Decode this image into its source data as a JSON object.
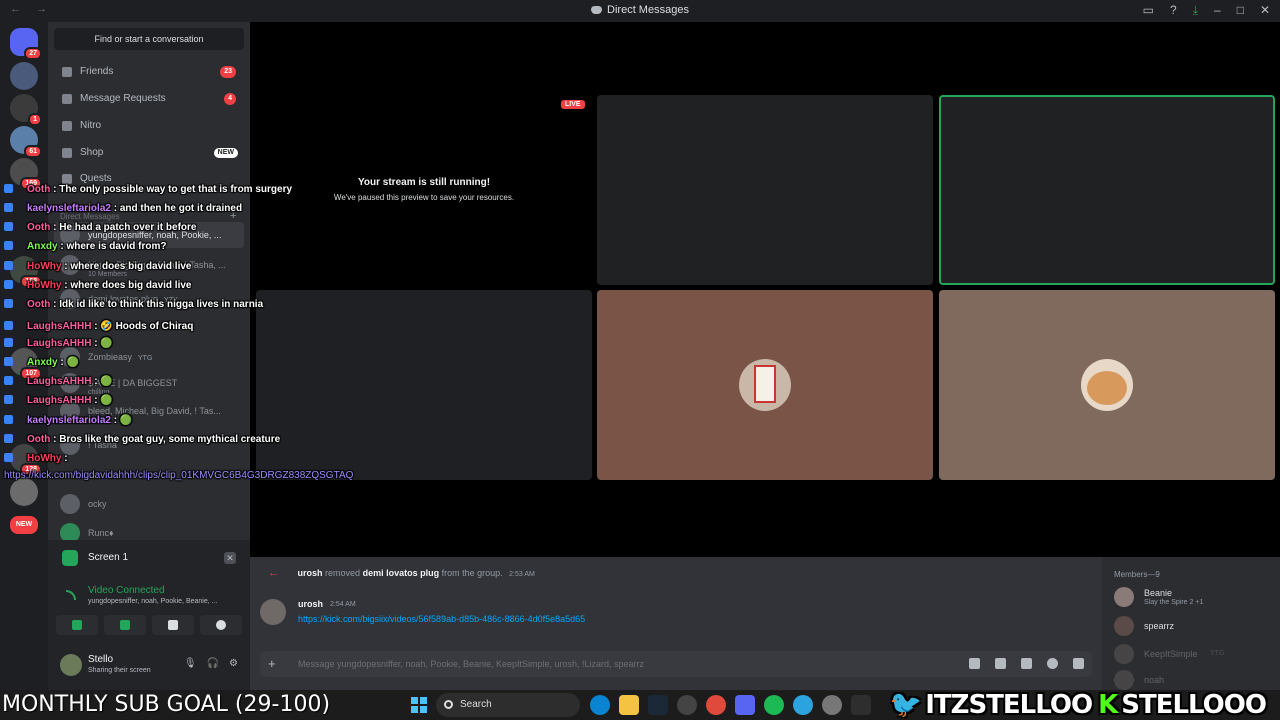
{
  "window": {
    "title": "Direct Messages",
    "nav": "←  →"
  },
  "search": {
    "label": "Find or start a conversation"
  },
  "nav": [
    {
      "label": "Friends",
      "count": "23"
    },
    {
      "label": "Message Requests",
      "count": "4"
    },
    {
      "label": "Nitro"
    },
    {
      "label": "Shop",
      "badge": "NEW"
    },
    {
      "label": "Quests"
    }
  ],
  "dm_header": "Direct Messages",
  "dms": [
    {
      "name": "yungdopesniffer, noah, Pookie, ..."
    },
    {
      "name": "Nigga, Big Nigga Noah, ! Tasha, ...",
      "sub": "10 Members"
    },
    {
      "name": "demi lovatos plug",
      "tag": "YZY"
    },
    {
      "name": "Zombieasy",
      "tag": "YTG"
    },
    {
      "name": "$ AP E | DA BIGGEST",
      "sub": "chilling"
    },
    {
      "name": "bleed, Micheal, Big David, ! Tas..."
    },
    {
      "name": "! Tasha"
    },
    {
      "name": "ocky"
    },
    {
      "name": "Runc♦"
    }
  ],
  "server_badges": {
    "top": "27",
    "b1": "1",
    "b2": "61",
    "b3": "169",
    "b4": "168",
    "b5": "107",
    "b6": "128",
    "new": "NEW"
  },
  "overlay": [
    {
      "user": "Ooth",
      "text": ": The only possible way to get that is from surgery"
    },
    {
      "user": "kaelynsleftariola2",
      "text": ": and then he got it drained"
    },
    {
      "user": "Ooth",
      "text": ": He had a patch over it before"
    },
    {
      "user": "Anxdy",
      "text": ": where is david from?"
    },
    {
      "user": "HoWhy",
      "text": ": where does big david live"
    },
    {
      "user": "HoWhy",
      "text": ": where does big david live"
    },
    {
      "user": "Ooth",
      "text": ": Idk id like to think this nigga lives in narnia"
    },
    {
      "user": "LaughsAHHH",
      "text": ": 🤣 Hoods of Chiraq"
    },
    {
      "user": "LaughsAHHH",
      "text": ": 🟢"
    },
    {
      "user": "Anxdy",
      "text": ": 🟢"
    },
    {
      "user": "LaughsAHHH",
      "text": ": 🟢"
    },
    {
      "user": "LaughsAHHH",
      "text": ": 🟢"
    },
    {
      "user": "kaelynsleftariola2",
      "text": ": 🟢"
    },
    {
      "user": "Ooth",
      "text": ": Bros like the goat guy, some mythical creature"
    },
    {
      "user": "HoWhy",
      "text": ":"
    },
    {
      "user": "",
      "text": "https://kick.com/bigdavidahhh/clips/clip_01KMVGC6B4G3DRGZ838ZQSGTAQ"
    }
  ],
  "voice": {
    "screen_label": "Screen 1",
    "status": "Video Connected",
    "channel": "yungdopesniffer, noah, Pookie, Beanie, ...",
    "user": "Stello",
    "user_status": "Sharing their screen"
  },
  "stage": {
    "live": "LIVE",
    "paused_title": "Your stream is still running!",
    "paused_sub": "We've paused this preview to save your resources."
  },
  "chat": {
    "system": {
      "actor": "urosh",
      "verb": "removed",
      "target": "demi lovatos plug",
      "rest": "from the group.",
      "time": "2:53 AM"
    },
    "message": {
      "author": "urosh",
      "time": "2:54 AM",
      "link": "https://kick.com/bigsiix/videos/56f589ab-d85b-486c-8866-4d0f5e8a5d65"
    },
    "placeholder": "Message yungdopesniffer, noah, Pookie, Beanie, KeepItSimple, urosh, !Lizard, spearrz"
  },
  "members": {
    "header": "Members—9",
    "list": [
      {
        "name": "Beanie",
        "status": "Slay the Spire 2 +1"
      },
      {
        "name": "spearrz"
      },
      {
        "name": "KeepItSimple",
        "tag": "YTG"
      },
      {
        "name": "noah"
      }
    ]
  },
  "taskbar": {
    "goal": "MONTHLY SUB GOAL (29-100)",
    "search": "Search",
    "twitter": "ITZSTELLOO",
    "kick": "STELLOOO"
  },
  "colors": {
    "accent": "#5865f2",
    "green": "#23a55a",
    "red": "#f23f43",
    "link": "#00a8fc"
  }
}
